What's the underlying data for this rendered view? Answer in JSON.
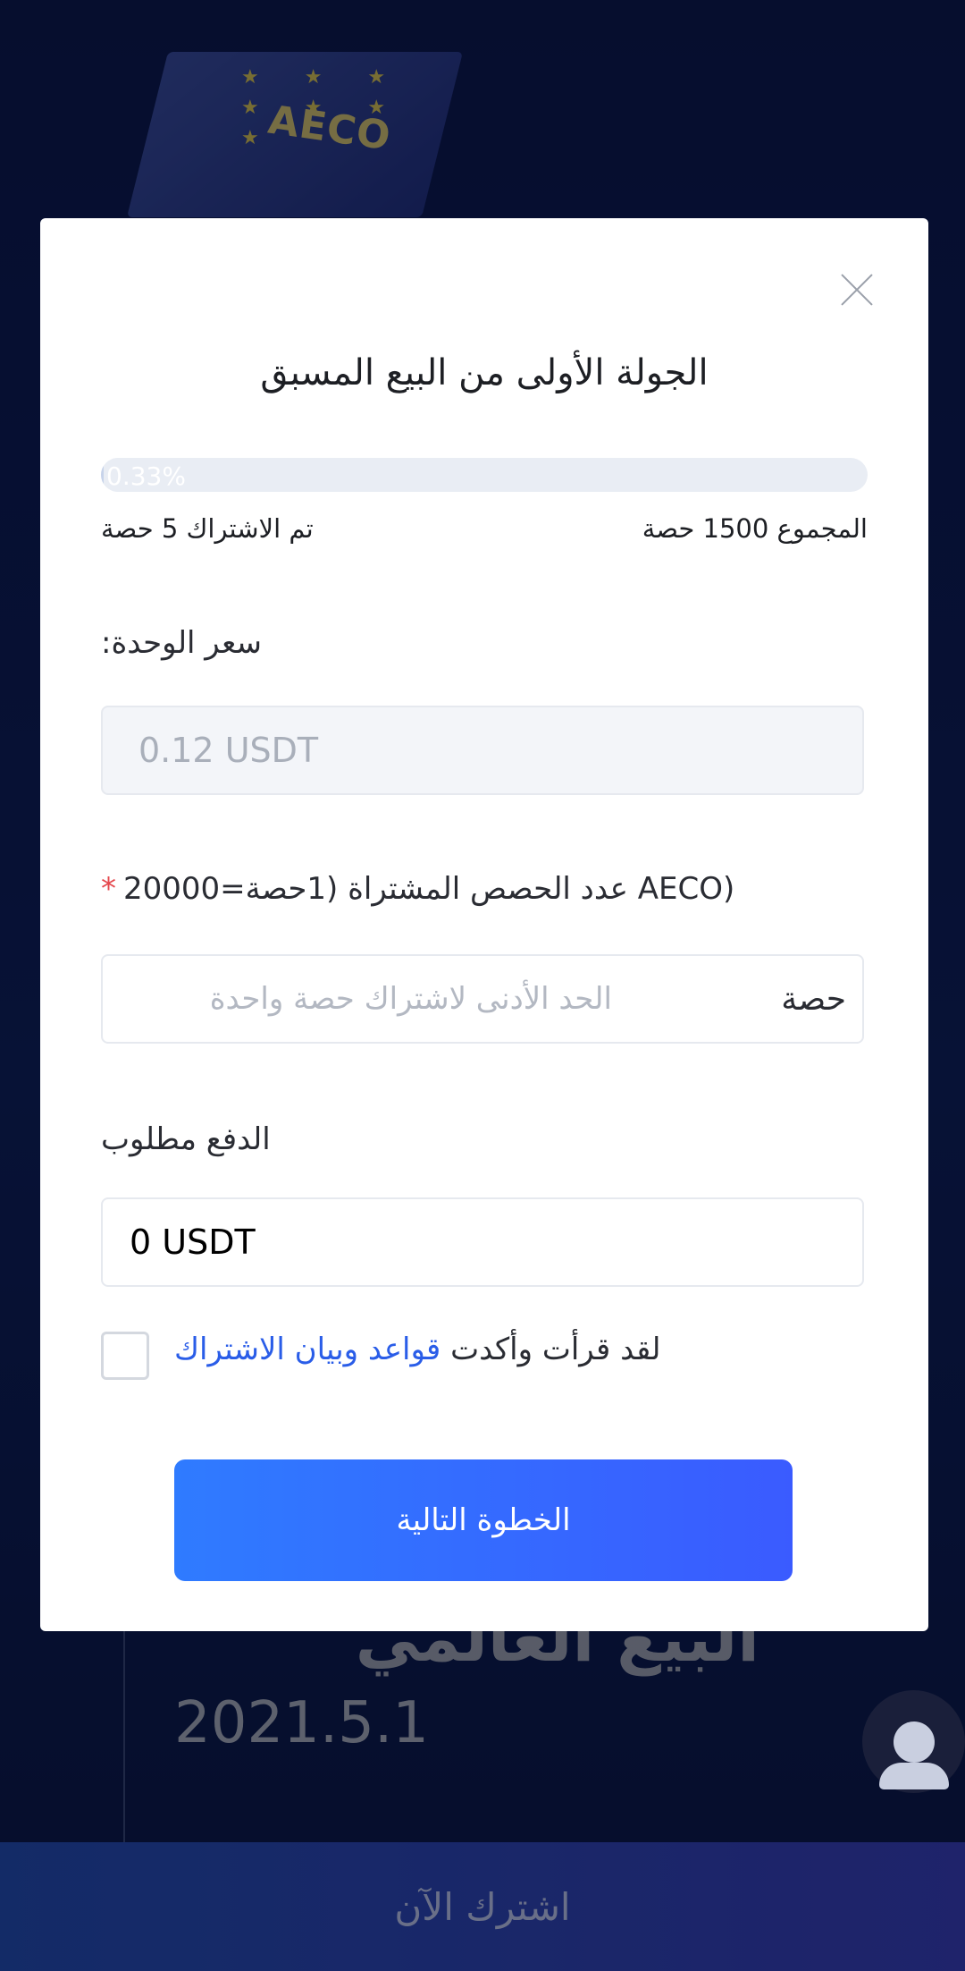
{
  "background": {
    "cube_text": "AECO",
    "headline": "البيع العالمي",
    "date": "2021.5.1",
    "subscribe_button": "اشترك الآن"
  },
  "modal": {
    "title": "الجولة الأولى من البيع المسبق",
    "progress": {
      "percent_label": "0.33%",
      "percent": 0.33,
      "subscribed": "تم الاشتراك 5 حصة",
      "total": "المجموع 1500 حصة"
    },
    "unit_price": {
      "label": "سعر الوحدة:",
      "value": "0.12 USDT"
    },
    "shares": {
      "label": "عدد الحصص المشتراة  (1حصة=20000",
      "label_suffix": "AECO)",
      "required_marker": "*",
      "placeholder": "الحد الأدنى لاشتراك حصة واحدة",
      "unit": "حصة"
    },
    "payment": {
      "label": "الدفع مطلوب",
      "value": "0 USDT"
    },
    "agreement": {
      "prefix": "لقد قرأت وأكدت",
      "link": "قواعد وبيان الاشتراك"
    },
    "next_button": "الخطوة التالية"
  },
  "colors": {
    "accent": "#2f7bff",
    "link": "#2a5de8",
    "required": "#e5484d"
  }
}
